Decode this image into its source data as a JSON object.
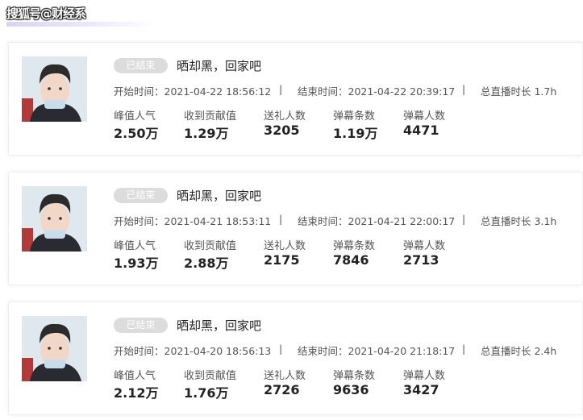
{
  "watermark": "搜狐号@财经系",
  "cards": [
    {
      "status": "已结束",
      "title": "晒却黑，回家吧",
      "start": "开始时间：2021-04-22 18:56:12",
      "end": "结束时间：2021-04-22 20:39:17",
      "duration": "总直播时长 1.7h",
      "stats": [
        {
          "label": "峰值人气",
          "value": "2.50万"
        },
        {
          "label": "收到贡献值",
          "value": "1.29万"
        },
        {
          "label": "送礼人数",
          "value": "3205"
        },
        {
          "label": "弹幕条数",
          "value": "1.19万"
        },
        {
          "label": "弹幕人数",
          "value": "4471"
        }
      ]
    },
    {
      "status": "已结束",
      "title": "晒却黑，回家吧",
      "start": "开始时间：2021-04-21 18:53:11",
      "end": "结束时间：2021-04-21 22:00:17",
      "duration": "总直播时长 3.1h",
      "stats": [
        {
          "label": "峰值人气",
          "value": "1.93万"
        },
        {
          "label": "收到贡献值",
          "value": "2.88万"
        },
        {
          "label": "送礼人数",
          "value": "2175"
        },
        {
          "label": "弹幕条数",
          "value": "7846"
        },
        {
          "label": "弹幕人数",
          "value": "2713"
        }
      ]
    },
    {
      "status": "已结束",
      "title": "晒却黑，回家吧",
      "start": "开始时间：2021-04-20 18:56:13",
      "end": "结束时间：2021-04-20 21:18:17",
      "duration": "总直播时长 2.4h",
      "stats": [
        {
          "label": "峰值人气",
          "value": "2.12万"
        },
        {
          "label": "收到贡献值",
          "value": "1.76万"
        },
        {
          "label": "送礼人数",
          "value": "2726"
        },
        {
          "label": "弹幕条数",
          "value": "9636"
        },
        {
          "label": "弹幕人数",
          "value": "3427"
        }
      ]
    }
  ],
  "separator": "|",
  "colors": {
    "accent": "#d8d4f3",
    "badge_bg": "#dcdcdc",
    "text_dark": "#222222",
    "text_muted": "#555555"
  }
}
